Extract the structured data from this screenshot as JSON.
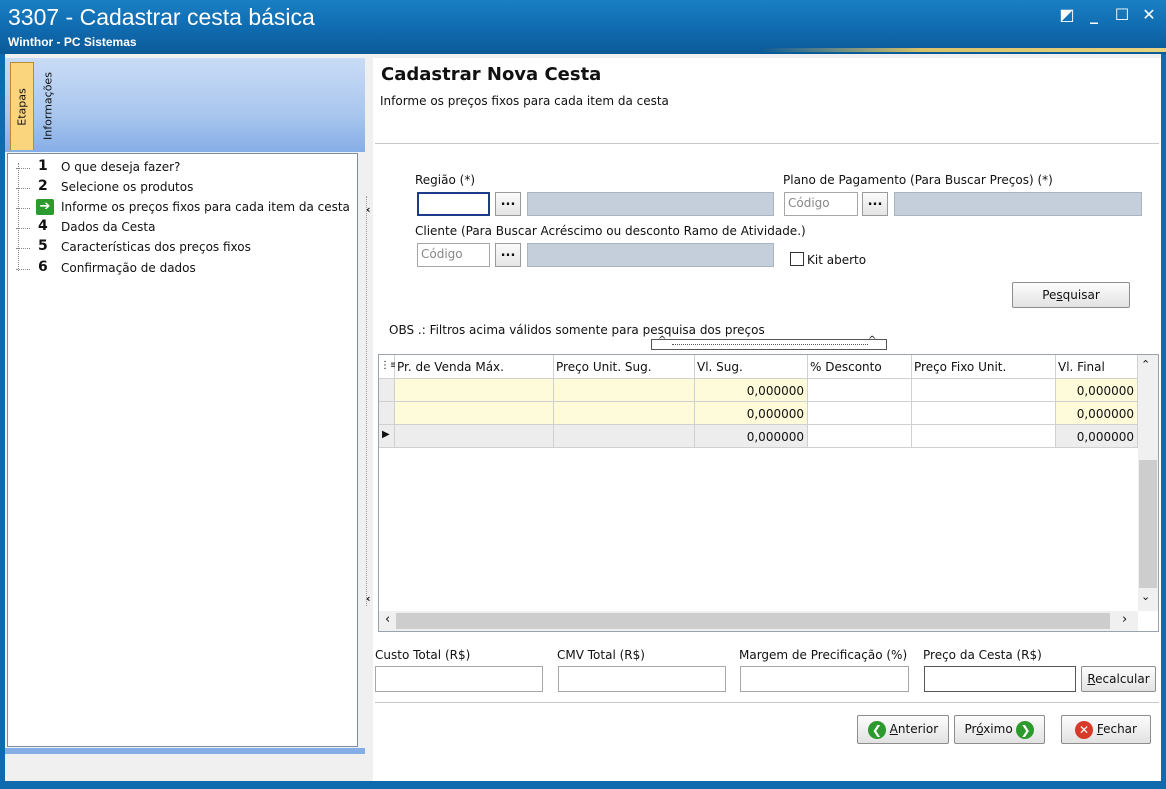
{
  "window": {
    "title": "3307 - Cadastrar cesta básica",
    "subtitle": "Winthor - PC Sistemas",
    "controls": {
      "restore": "◩",
      "minimize": "_",
      "maximize": "☐",
      "close": "✕"
    }
  },
  "sidebar": {
    "tabs": [
      "Etapas",
      "Informações"
    ],
    "steps": [
      {
        "num": "1",
        "label": "O que deseja fazer?"
      },
      {
        "num": "2",
        "label": "Selecione os produtos"
      },
      {
        "num": "",
        "label": "Informe os preços fixos para cada item da cesta",
        "current": true
      },
      {
        "num": "4",
        "label": "Dados da Cesta"
      },
      {
        "num": "5",
        "label": "Características dos preços fixos"
      },
      {
        "num": "6",
        "label": "Confirmação de dados"
      }
    ]
  },
  "main": {
    "title": "Cadastrar Nova Cesta",
    "subtitle": "Informe os preços fixos para cada item da cesta",
    "form": {
      "regiao_label": "Região (*)",
      "plano_label": "Plano de Pagamento (Para Buscar Preços) (*)",
      "plano_placeholder": "Código",
      "cliente_label": "Cliente (Para Buscar Acréscimo ou desconto Ramo de Atividade.)",
      "cliente_placeholder": "Código",
      "kit_label": "Kit aberto",
      "lookup_btn": "...",
      "pesquisar_pre": "Pe",
      "pesquisar_u": "s",
      "pesquisar_post": "quisar",
      "obs": "OBS .: Filtros acima válidos somente para pesquisa dos preços"
    },
    "grid": {
      "columns": [
        "Pr. de Venda Máx.",
        "Preço Unit. Sug.",
        "Vl. Sug.",
        "% Desconto",
        "Preço Fixo Unit.",
        "Vl. Final"
      ],
      "rows": [
        {
          "vl_sug": "0,000000",
          "vl_final": "0,000000"
        },
        {
          "vl_sug": "0,000000",
          "vl_final": "0,000000"
        },
        {
          "vl_sug": "0,000000",
          "vl_final": "0,000000"
        }
      ]
    },
    "totals": {
      "custo_label": "Custo Total (R$)",
      "cmv_label": "CMV Total (R$)",
      "margem_label": "Margem de Precificação (%)",
      "preco_label": "Preço da Cesta (R$)",
      "recalcular_u": "R",
      "recalcular_rest": "ecalcular"
    },
    "buttons": {
      "anterior_u": "A",
      "anterior_rest": "nterior",
      "proximo_pre": "Pr",
      "proximo_u": "ó",
      "proximo_post": "ximo",
      "fechar_u": "F",
      "fechar_rest": "echar"
    }
  },
  "colors": {
    "title_bar": "#0f6aae",
    "tab_active": "#fbd47e",
    "row_highlight": "#fdfbd9"
  }
}
